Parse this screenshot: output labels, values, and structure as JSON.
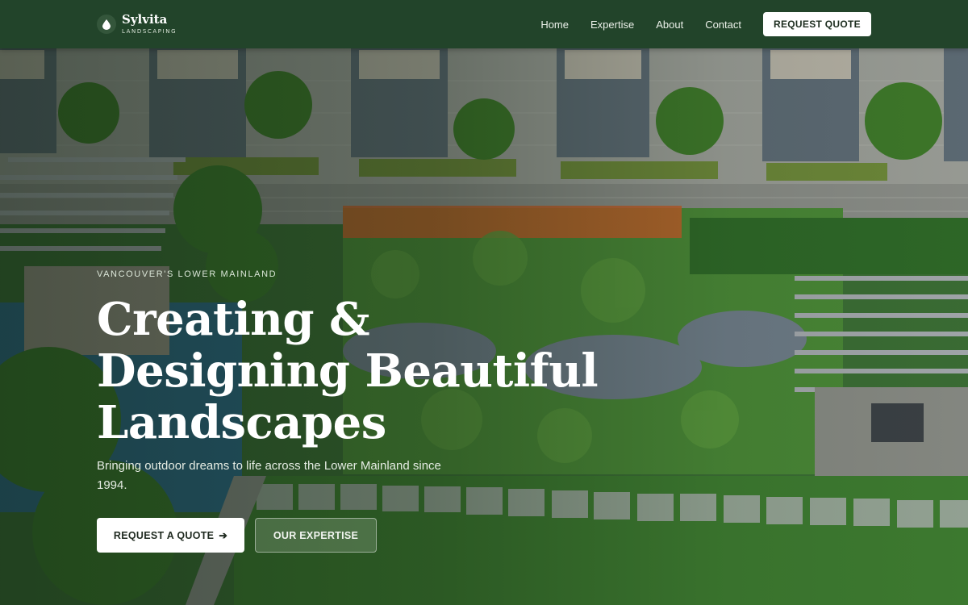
{
  "brand": {
    "name": "Sylvita",
    "tagline": "LANDSCAPING",
    "logo_icon": "leaf-drop-icon"
  },
  "nav": {
    "links": [
      "Home",
      "Expertise",
      "About",
      "Contact"
    ],
    "cta_label": "REQUEST QUOTE"
  },
  "hero": {
    "eyebrow": "VANCOUVER'S LOWER MAINLAND",
    "headline_lines": [
      "Creating &",
      "Designing Beautiful",
      "Landscapes"
    ],
    "subtitle": "Bringing outdoor dreams to life across the Lower Mainland since 1994.",
    "primary_button": "REQUEST A QUOTE",
    "primary_button_icon": "arrow-right-icon",
    "secondary_button": "OUR EXPERTISE"
  },
  "colors": {
    "navbar": "#22442a",
    "button_primary_bg": "#ffffff",
    "text_light": "#ffffff"
  }
}
